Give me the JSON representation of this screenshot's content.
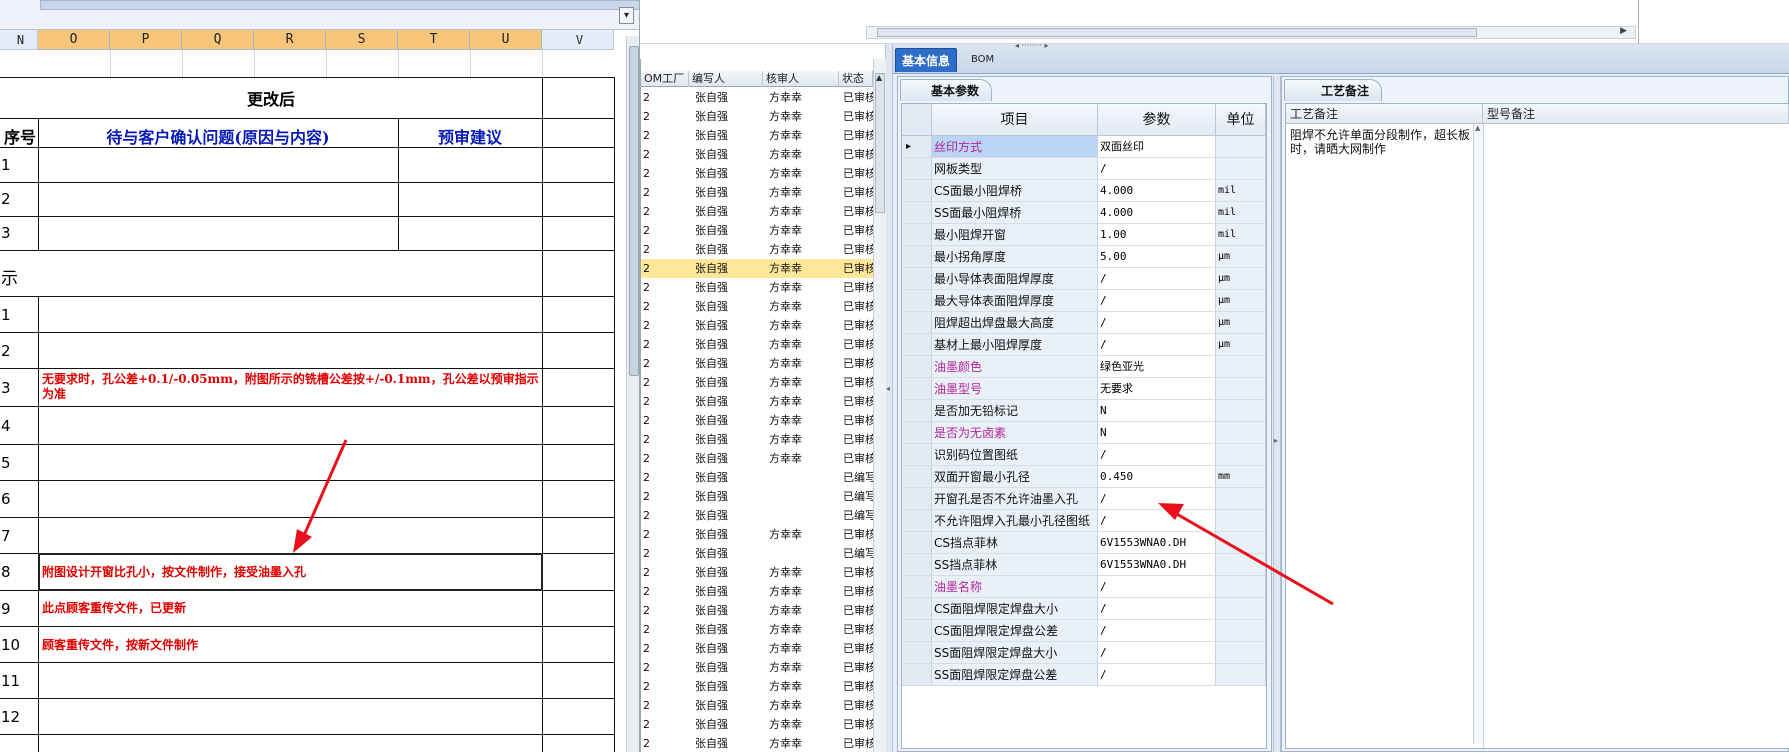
{
  "sheet": {
    "columns": [
      "N",
      "O",
      "P",
      "Q",
      "R",
      "S",
      "T",
      "U",
      "V"
    ],
    "header_after": "更改后",
    "col_no_label": "序号",
    "col_issue_label": "待与客户确认问题(原因与内容)",
    "col_suggestion_label": "预审建议",
    "section_label": "示",
    "row_numbers_a": [
      "1",
      "2",
      "3"
    ],
    "row_numbers_b": [
      "1",
      "2",
      "3",
      "4",
      "5",
      "6",
      "7",
      "8",
      "9",
      "10",
      "11",
      "12"
    ],
    "notes": {
      "row3": "无要求时，孔公差+0.1/-0.05mm，附图所示的铣槽公差按+/-0.1mm，孔公差以预审指示为准",
      "row8": "附图设计开窗比孔小，按文件制作，接受油墨入孔",
      "row9": "此点顾客重传文件，已更新",
      "row10": "顾客重传文件，按新文件制作"
    }
  },
  "midlist": {
    "headers": [
      "OM工厂",
      "编写人",
      "核审人",
      "状态"
    ],
    "rows": [
      {
        "a": "2",
        "w": "张自强",
        "r": "方幸幸",
        "s": "已审核"
      },
      {
        "a": "2",
        "w": "张自强",
        "r": "方幸幸",
        "s": "已审核"
      },
      {
        "a": "2",
        "w": "张自强",
        "r": "方幸幸",
        "s": "已审核"
      },
      {
        "a": "2",
        "w": "张自强",
        "r": "方幸幸",
        "s": "已审核"
      },
      {
        "a": "2",
        "w": "张自强",
        "r": "方幸幸",
        "s": "已审核"
      },
      {
        "a": "2",
        "w": "张自强",
        "r": "方幸幸",
        "s": "已审核"
      },
      {
        "a": "2",
        "w": "张自强",
        "r": "方幸幸",
        "s": "已审核"
      },
      {
        "a": "2",
        "w": "张自强",
        "r": "方幸幸",
        "s": "已审核"
      },
      {
        "a": "2",
        "w": "张自强",
        "r": "方幸幸",
        "s": "已审核"
      },
      {
        "a": "2",
        "w": "张自强",
        "r": "方幸幸",
        "s": "已审核"
      },
      {
        "a": "2",
        "w": "张自强",
        "r": "方幸幸",
        "s": "已审核"
      },
      {
        "a": "2",
        "w": "张自强",
        "r": "方幸幸",
        "s": "已审核"
      },
      {
        "a": "2",
        "w": "张自强",
        "r": "方幸幸",
        "s": "已审核"
      },
      {
        "a": "2",
        "w": "张自强",
        "r": "方幸幸",
        "s": "已审核"
      },
      {
        "a": "2",
        "w": "张自强",
        "r": "方幸幸",
        "s": "已审核"
      },
      {
        "a": "2",
        "w": "张自强",
        "r": "方幸幸",
        "s": "已审核"
      },
      {
        "a": "2",
        "w": "张自强",
        "r": "方幸幸",
        "s": "已审核"
      },
      {
        "a": "2",
        "w": "张自强",
        "r": "方幸幸",
        "s": "已审核"
      },
      {
        "a": "2",
        "w": "张自强",
        "r": "方幸幸",
        "s": "已审核"
      },
      {
        "a": "2",
        "w": "张自强",
        "r": "方幸幸",
        "s": "已审核"
      },
      {
        "a": "2",
        "w": "张自强",
        "r": "",
        "s": "已编写"
      },
      {
        "a": "2",
        "w": "张自强",
        "r": "",
        "s": "已编写"
      },
      {
        "a": "2",
        "w": "张自强",
        "r": "",
        "s": "已编写"
      },
      {
        "a": "2",
        "w": "张自强",
        "r": "方幸幸",
        "s": "已审核"
      },
      {
        "a": "2",
        "w": "张自强",
        "r": "",
        "s": "已编写"
      },
      {
        "a": "2",
        "w": "张自强",
        "r": "方幸幸",
        "s": "已审核"
      },
      {
        "a": "2",
        "w": "张自强",
        "r": "方幸幸",
        "s": "已审核"
      },
      {
        "a": "2",
        "w": "张自强",
        "r": "方幸幸",
        "s": "已审核"
      },
      {
        "a": "2",
        "w": "张自强",
        "r": "方幸幸",
        "s": "已审核"
      },
      {
        "a": "2",
        "w": "张自强",
        "r": "方幸幸",
        "s": "已审核"
      },
      {
        "a": "2",
        "w": "张自强",
        "r": "方幸幸",
        "s": "已审核"
      },
      {
        "a": "2",
        "w": "张自强",
        "r": "方幸幸",
        "s": "已审核"
      },
      {
        "a": "2",
        "w": "张自强",
        "r": "方幸幸",
        "s": "已审核"
      },
      {
        "a": "2",
        "w": "张自强",
        "r": "方幸幸",
        "s": "已审核"
      },
      {
        "a": "2",
        "w": "张自强",
        "r": "方幸幸",
        "s": "已审核"
      }
    ],
    "selected_index": 9
  },
  "tabs": {
    "basic_info": "基本信息",
    "bom": "BOM"
  },
  "params": {
    "panel_title": "基本参数",
    "headers": {
      "item": "项目",
      "value": "参数",
      "unit": "单位"
    },
    "rows": [
      {
        "item": "丝印方式",
        "value": "双面丝印",
        "unit": "",
        "pink": true,
        "sel": true
      },
      {
        "item": "网板类型",
        "value": "/",
        "unit": "",
        "pink": false
      },
      {
        "item": "CS面最小阻焊桥",
        "value": "4.000",
        "unit": "mil",
        "pink": false
      },
      {
        "item": "SS面最小阻焊桥",
        "value": "4.000",
        "unit": "mil",
        "pink": false
      },
      {
        "item": "最小阻焊开窗",
        "value": "1.00",
        "unit": "mil",
        "pink": false
      },
      {
        "item": "最小拐角厚度",
        "value": "5.00",
        "unit": "μm",
        "pink": false
      },
      {
        "item": "最小导体表面阻焊厚度",
        "value": "/",
        "unit": "μm",
        "pink": false
      },
      {
        "item": "最大导体表面阻焊厚度",
        "value": "/",
        "unit": "μm",
        "pink": false
      },
      {
        "item": "阻焊超出焊盘最大高度",
        "value": "/",
        "unit": "μm",
        "pink": false
      },
      {
        "item": "基材上最小阻焊厚度",
        "value": "/",
        "unit": "μm",
        "pink": false
      },
      {
        "item": "油墨颜色",
        "value": "绿色亚光",
        "unit": "",
        "pink": true
      },
      {
        "item": "油墨型号",
        "value": "无要求",
        "unit": "",
        "pink": true
      },
      {
        "item": "是否加无铅标记",
        "value": "N",
        "unit": "",
        "pink": false
      },
      {
        "item": "是否为无卤素",
        "value": "N",
        "unit": "",
        "pink": true
      },
      {
        "item": "识别码位置图纸",
        "value": "/",
        "unit": "",
        "pink": false
      },
      {
        "item": "双面开窗最小孔径",
        "value": "0.450",
        "unit": "mm",
        "pink": false
      },
      {
        "item": "开窗孔是否不允许油墨入孔",
        "value": "/",
        "unit": "",
        "pink": false
      },
      {
        "item": "不允许阻焊入孔最小孔径图纸",
        "value": "/",
        "unit": "",
        "pink": false
      },
      {
        "item": "CS挡点菲林",
        "value": "6V1553WNA0.DH",
        "unit": "",
        "pink": false
      },
      {
        "item": "SS挡点菲林",
        "value": "6V1553WNA0.DH",
        "unit": "",
        "pink": false
      },
      {
        "item": "油墨名称",
        "value": "/",
        "unit": "",
        "pink": true
      },
      {
        "item": "CS面阻焊限定焊盘大小",
        "value": "/",
        "unit": "",
        "pink": false
      },
      {
        "item": "CS面阻焊限定焊盘公差",
        "value": "/",
        "unit": "",
        "pink": false
      },
      {
        "item": "SS面阻焊限定焊盘大小",
        "value": "/",
        "unit": "",
        "pink": false
      },
      {
        "item": "SS面阻焊限定焊盘公差",
        "value": "/",
        "unit": "",
        "pink": false
      }
    ]
  },
  "notes": {
    "panel_title": "工艺备注",
    "col_process": "工艺备注",
    "col_model": "型号备注",
    "process_note": "阻焊不允许单面分段制作，超长板时，请晒大网制作"
  },
  "colors": {
    "accent": "#2d6ec9",
    "arrow": "#e8101a",
    "note_red": "#e00000",
    "pink": "#b3259a",
    "selected_row": "#ffe79a"
  }
}
